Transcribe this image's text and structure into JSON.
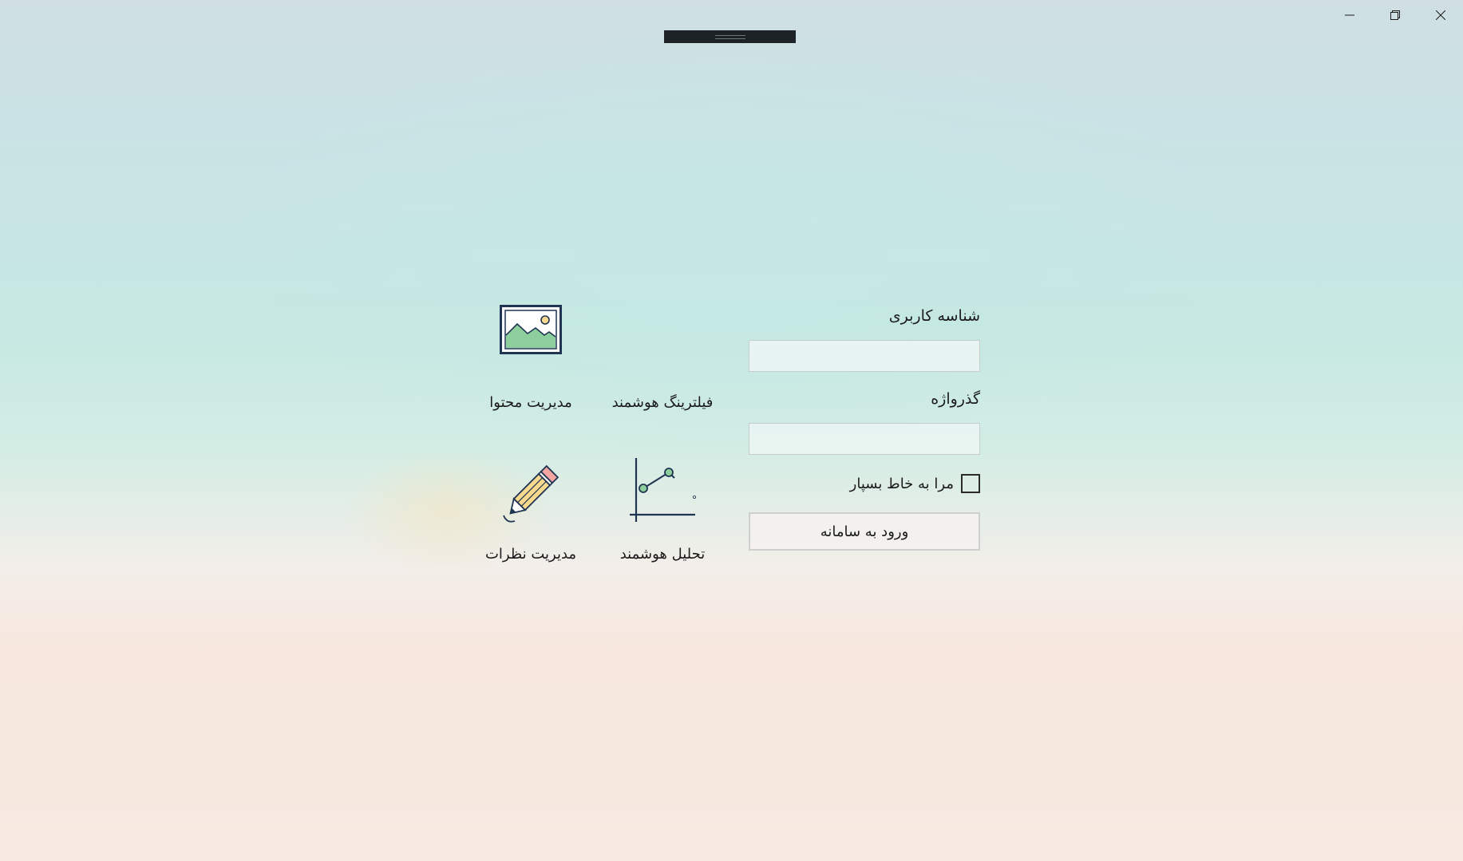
{
  "window": {
    "controls": {
      "minimize_icon": "minimize-icon",
      "restore_icon": "restore-icon",
      "close_icon": "close-icon"
    }
  },
  "login": {
    "username_label": "شناسه کاربری",
    "username_value": "",
    "password_label": "گذرواژه",
    "password_value": "",
    "remember_label": "مرا به خاط بسپار",
    "remember_checked": false,
    "submit_label": "ورود به سامانه"
  },
  "tiles": [
    {
      "label": "مدیریت محتوا",
      "icon": "image-icon"
    },
    {
      "label": "فیلترینگ هوشمند",
      "icon": ""
    },
    {
      "label": "مدیریت نظرات",
      "icon": "pencil-icon"
    },
    {
      "label": "تحلیل هوشمند",
      "icon": "line-chart-icon"
    }
  ],
  "colors": {
    "icon_navy": "#1f3552",
    "icon_green": "#8ccf9c",
    "pencil_yellow": "#f8d98e",
    "pencil_pink": "#f3a5a1"
  }
}
